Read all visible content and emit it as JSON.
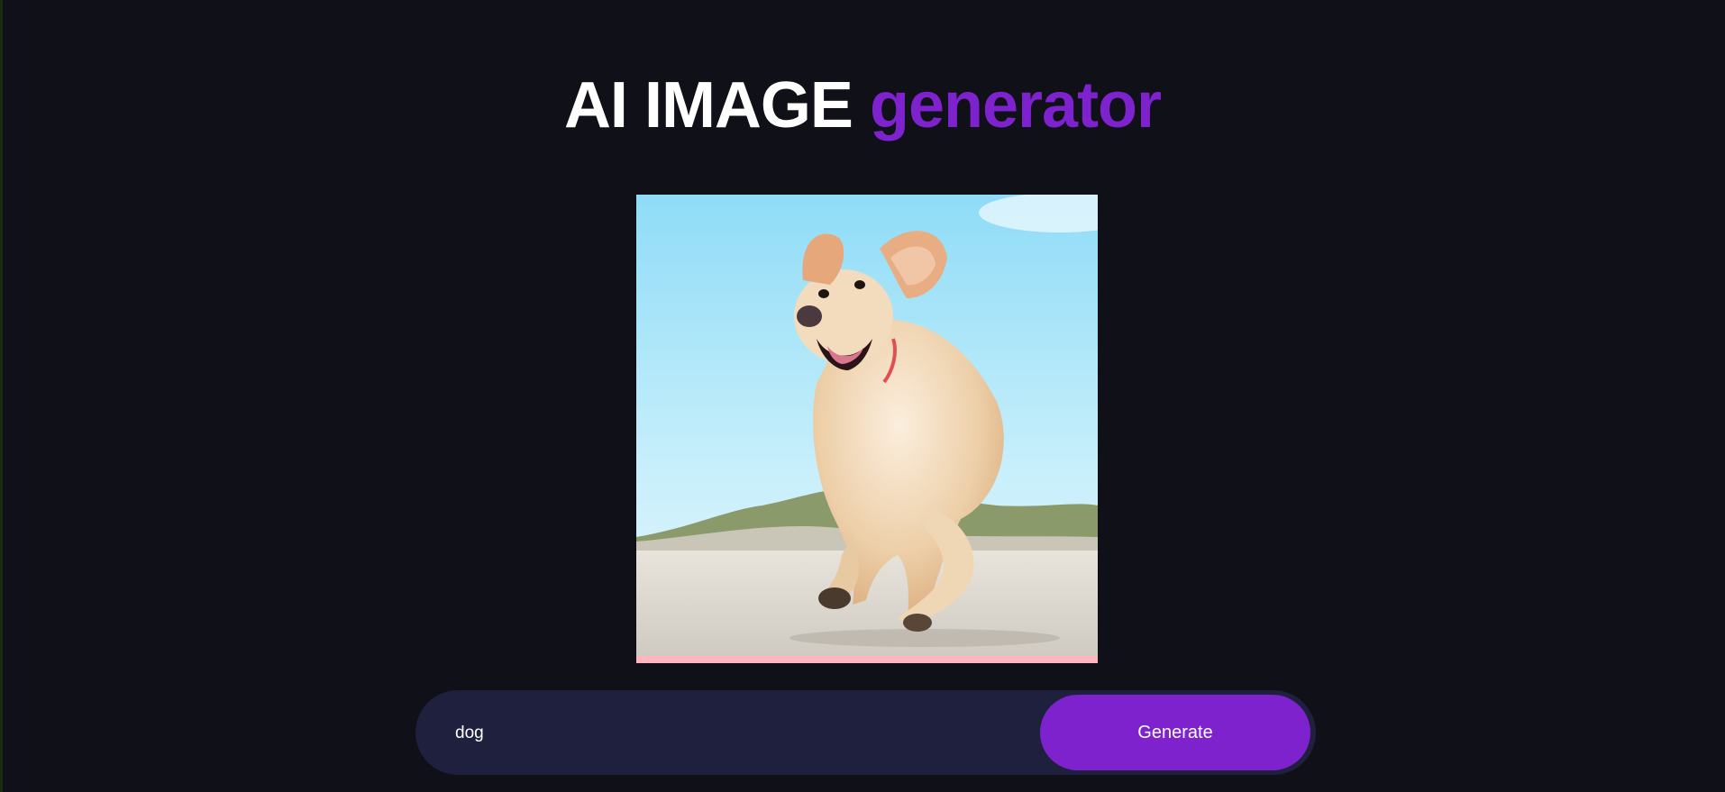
{
  "header": {
    "title_main": "AI IMAGE",
    "title_accent": "generator"
  },
  "image": {
    "alt": "dog",
    "subject": "golden retriever running on a beach",
    "loading_progress": 1.0
  },
  "prompt": {
    "value": "dog",
    "placeholder": ""
  },
  "actions": {
    "generate_label": "Generate"
  },
  "colors": {
    "background": "#101019",
    "accent": "#7e22ce",
    "input_bg": "#1f1f3e",
    "loading_bar": "#ffb6c1",
    "text": "#ffffff"
  }
}
